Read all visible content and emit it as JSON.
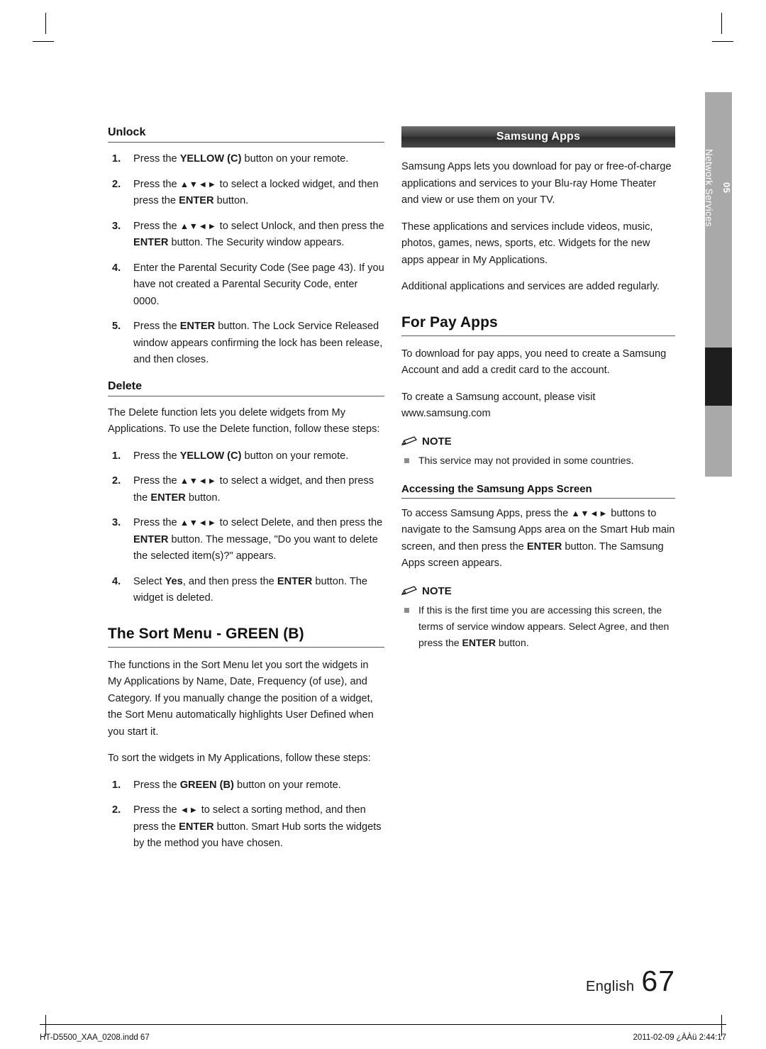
{
  "crop_marks": true,
  "left_column": {
    "unlock": {
      "heading": "Unlock",
      "steps": [
        {
          "num": "1.",
          "html": "Press the <b>YELLOW (C)</b> button on your remote."
        },
        {
          "num": "2.",
          "html": "Press the <span class=\"arrows\">▲▼◄►</span> to select a locked widget, and then press the <b>ENTER</b> button."
        },
        {
          "num": "3.",
          "html": "Press the <span class=\"arrows\">▲▼◄►</span> to select Unlock, and then press the <b>ENTER</b> button. The Security window appears."
        },
        {
          "num": "4.",
          "html": "Enter the Parental Security Code (See page 43). If you have not created a Parental Security Code, enter 0000."
        },
        {
          "num": "5.",
          "html": "Press the <b>ENTER</b> button. The Lock Service Released window appears confirming the lock has been release, and then closes."
        }
      ]
    },
    "delete": {
      "heading": "Delete",
      "intro": "The Delete function lets you delete widgets from My Applications. To use the Delete function, follow these steps:",
      "steps": [
        {
          "num": "1.",
          "html": "Press the <b>YELLOW (C)</b> button on your remote."
        },
        {
          "num": "2.",
          "html": "Press the <span class=\"arrows\">▲▼◄►</span> to select a widget, and then press the <b>ENTER</b> button."
        },
        {
          "num": "3.",
          "html": "Press the <span class=\"arrows\">▲▼◄►</span> to select Delete, and then press the <b>ENTER</b> button. The message, \"Do you want to delete the selected item(s)?\" appears."
        },
        {
          "num": "4.",
          "html": "Select <b>Yes</b>, and then press the <b>ENTER</b> button. The widget is deleted."
        }
      ]
    },
    "sort_menu": {
      "heading": "The Sort Menu - GREEN (B)",
      "paragraphs": [
        "The functions in the Sort Menu let you sort the widgets in My Applications by Name, Date, Frequency (of use), and Category. If you manually change the position of a widget, the Sort Menu automatically highlights User Defined when you start it.",
        "To sort the widgets in My Applications, follow these steps:"
      ],
      "steps": [
        {
          "num": "1.",
          "html": "Press the <b>GREEN (B)</b> button on your remote."
        },
        {
          "num": "2.",
          "html": "Press the <span class=\"arrows\">◄►</span> to select a sorting method, and then press the <b>ENTER</b> button. Smart Hub sorts the widgets by the method you have chosen."
        }
      ]
    }
  },
  "right_column": {
    "banner_title": "Samsung Apps",
    "intro_paragraphs": [
      "Samsung Apps lets you download for pay or free-of-charge applications and services to your Blu-ray Home Theater and view or use them on your TV.",
      "These applications and services include videos, music, photos, games, news, sports, etc. Widgets for the new apps appear in My Applications.",
      "Additional applications and services are added regularly."
    ],
    "for_pay_apps": {
      "heading": "For Pay Apps",
      "paragraphs": [
        "To download for pay apps, you need to create a Samsung Account and add a credit card to the account.",
        "To create a Samsung account, please visit www.samsung.com"
      ],
      "note_label": "NOTE",
      "note_items": [
        "This service may not provided in some countries."
      ]
    },
    "accessing": {
      "heading": "Accessing the Samsung Apps Screen",
      "paragraph_html": "To access Samsung Apps, press the <span class=\"arrows\">▲▼◄►</span> buttons to navigate to the Samsung Apps area on the Smart Hub main screen, and then press the <b>ENTER</b> button. The Samsung Apps screen appears.",
      "note_label": "NOTE",
      "note_items_html": [
        "If this is the first time you are accessing this screen, the terms of service window appears. Select Agree, and then press the <b>ENTER</b> button."
      ]
    }
  },
  "side_tab": {
    "chapter_number": "05",
    "chapter_title": "Network Services"
  },
  "footer": {
    "language": "English",
    "page_number": "67",
    "file_info": "HT-D5500_XAA_0208.indd   67",
    "date_info": "2011-02-09   ¿ÀÀü 2:44:17"
  }
}
